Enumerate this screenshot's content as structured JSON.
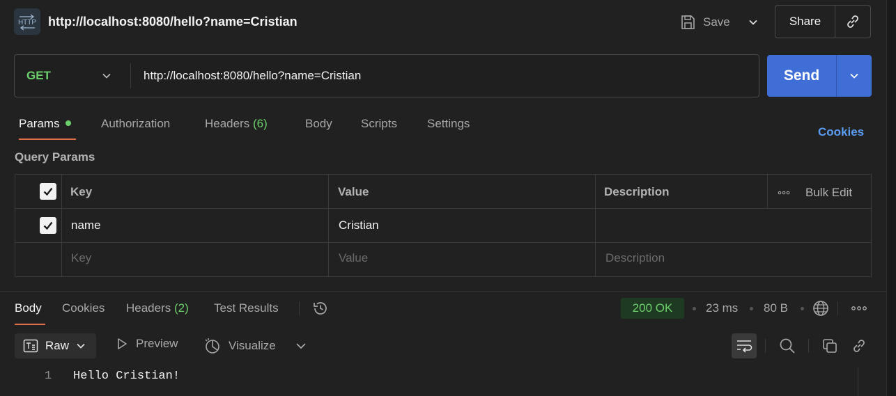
{
  "header": {
    "badge_text": "HTTP",
    "title": "http://localhost:8080/hello?name=Cristian",
    "save_label": "Save",
    "share_label": "Share"
  },
  "request": {
    "method": "GET",
    "url": "http://localhost:8080/hello?name=Cristian",
    "send_label": "Send"
  },
  "request_tabs": {
    "params": "Params",
    "authorization": "Authorization",
    "headers": "Headers",
    "headers_count": "(6)",
    "body": "Body",
    "scripts": "Scripts",
    "settings": "Settings",
    "cookies": "Cookies"
  },
  "query_params": {
    "section_title": "Query Params",
    "columns": {
      "key": "Key",
      "value": "Value",
      "description": "Description"
    },
    "bulk_edit_label": "Bulk Edit",
    "rows": [
      {
        "checked": true,
        "key": "name",
        "value": "Cristian",
        "description": ""
      }
    ],
    "placeholders": {
      "key": "Key",
      "value": "Value",
      "description": "Description"
    }
  },
  "response_tabs": {
    "body": "Body",
    "cookies": "Cookies",
    "headers": "Headers",
    "headers_count": "(2)",
    "test_results": "Test Results"
  },
  "response_meta": {
    "status": "200 OK",
    "time": "23 ms",
    "size": "80 B"
  },
  "response_toolbar": {
    "raw_label": "Raw",
    "preview_label": "Preview",
    "visualize_label": "Visualize"
  },
  "response_body": {
    "line_number": "1",
    "line_text": "Hello Cristian!"
  },
  "colors": {
    "accent_orange": "#e0704a",
    "send_blue": "#3f6ed6",
    "success_green": "#6bd06b",
    "link_blue": "#5b9cf2"
  }
}
